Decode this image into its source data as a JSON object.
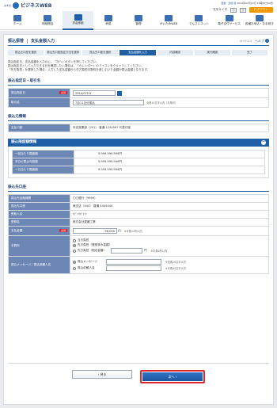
{
  "header": {
    "brand_pre": "みずほ",
    "brand": "ビジネスWEB",
    "user_line1": "愛媛　太郎 様",
    "user_line2": "2014年07月10日 10時00分00秒",
    "font_size_label": "文字サイズ",
    "font_small": "小",
    "font_large": "大",
    "logout": "ログアウト"
  },
  "nav": [
    {
      "label": "ホーム",
      "active": false
    },
    {
      "label": "明細照会",
      "active": false
    },
    {
      "label": "資金移動",
      "active": true
    },
    {
      "label": "承認",
      "active": false
    },
    {
      "label": "管理",
      "active": false
    },
    {
      "label": "がいためWEB",
      "active": false
    },
    {
      "label": "でんさいネット",
      "active": false
    },
    {
      "label": "電子交付サービス",
      "active": false
    },
    {
      "label": "各種お申込・お手続き",
      "active": false
    }
  ],
  "title": {
    "section": "振込振替",
    "page": "支払金額入力",
    "code": "BFKF029",
    "help": "ヘルプ"
  },
  "steps": [
    "振込元口座を選択",
    "振込先口座指定方法を選択",
    "振込先口座を選択",
    "支払金額を入力",
    "内容確認",
    "実行確認",
    "完了"
  ],
  "intro": [
    "振込指定日、支払金額を入力の上、「次へ」ボタンを押してください。",
    "振込指定日として入力できる日を確認したい場合は、「カレンダー」のアイコンをクリックしてください。",
    "「先方負担」を選択した場合、入力した支払金額から先方負担手数料を差し引いた金額が振込金額となります。"
  ],
  "schedule": {
    "heading": "振込指定日・取引名",
    "date_label": "振込指定日",
    "required": "必須",
    "date_value": "2014/07/11",
    "name_label": "取引名",
    "name_value": "7月11日分振込",
    "name_note": "全角10文字以内［半角可］"
  },
  "source": {
    "heading": "振込元情報",
    "label": "支払口座",
    "value": "本店営業部（201） 普通 1234567 代表口座"
  },
  "limits": {
    "heading": "振込限度額情報",
    "rows": [
      {
        "label": "一回当たり限度額",
        "value": "9,999,999,999円"
      },
      {
        "label": "本日の振込可能額",
        "value": "9,999,999,999円"
      },
      {
        "label": "一日当たり限度額",
        "value": "9,999,999,999円"
      }
    ]
  },
  "dest": {
    "heading": "振込先口座",
    "rows": [
      {
        "label": "振込先金融機関",
        "value": "〇〇銀行（9999）"
      },
      {
        "label": "振込先口座",
        "value": "東支店（444） 普通 4444444"
      },
      {
        "label": "受取人名",
        "value": "ｶﾌﾞｼｷｶﾞｲｼｬ"
      },
      {
        "label": "登録名",
        "value": "株式会社愛媛工業"
      }
    ],
    "amount_label": "支払金額",
    "amount_value": "98,000",
    "amount_unit": "円",
    "amount_note": "※半角11桁以内",
    "fee_label": "手数料",
    "fee_options": [
      {
        "label": "当方負担",
        "selected": false
      },
      {
        "label": "先方負担（登録済み金額）",
        "selected": true
      },
      {
        "label": "先方負担（指定金額）",
        "selected": false
      }
    ],
    "fee_unit": "円",
    "fee_note": "※半角4桁以内",
    "msg_label": "振込メッセージ／振込依頼人名",
    "msg_options": [
      {
        "label": "振込メッセージ",
        "selected": true,
        "note": "※全角20文字以内"
      },
      {
        "label": "振込依頼人名",
        "selected": false,
        "note": "※半角40文字以内"
      }
    ]
  },
  "buttons": {
    "back": "戻る",
    "next": "次へ"
  }
}
